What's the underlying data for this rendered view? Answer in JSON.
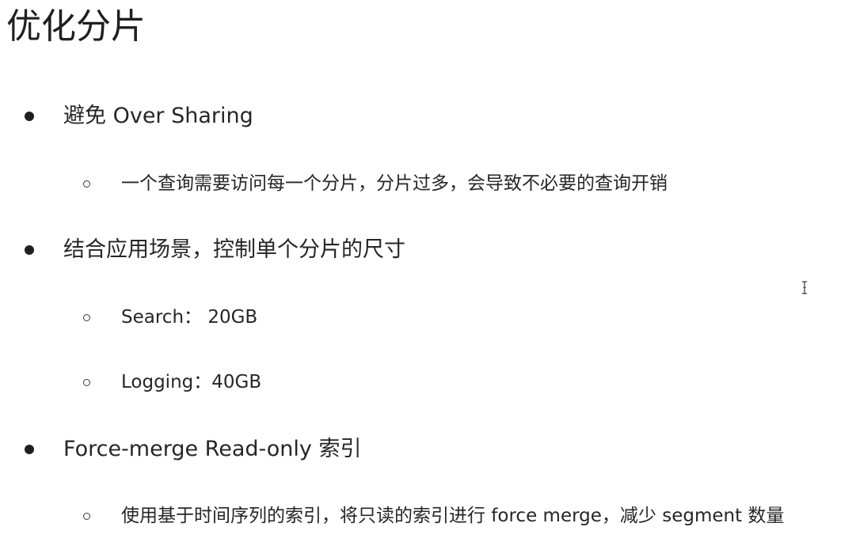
{
  "slide": {
    "title": "优化分片",
    "bullets": [
      {
        "text": "避免 Over Sharing",
        "sub": [
          "一个查询需要访问每一个分片，分片过多，会导致不必要的查询开销"
        ]
      },
      {
        "text": "结合应用场景，控制单个分片的尺寸",
        "sub": [
          "Search： 20GB",
          "Logging：40GB"
        ]
      },
      {
        "text": "Force-merge Read-only 索引",
        "sub": [
          "使用基于时间序列的索引，将只读的索引进行 force merge，减少 segment 数量"
        ]
      }
    ]
  },
  "cursor": {
    "icon": "text-cursor-icon"
  }
}
